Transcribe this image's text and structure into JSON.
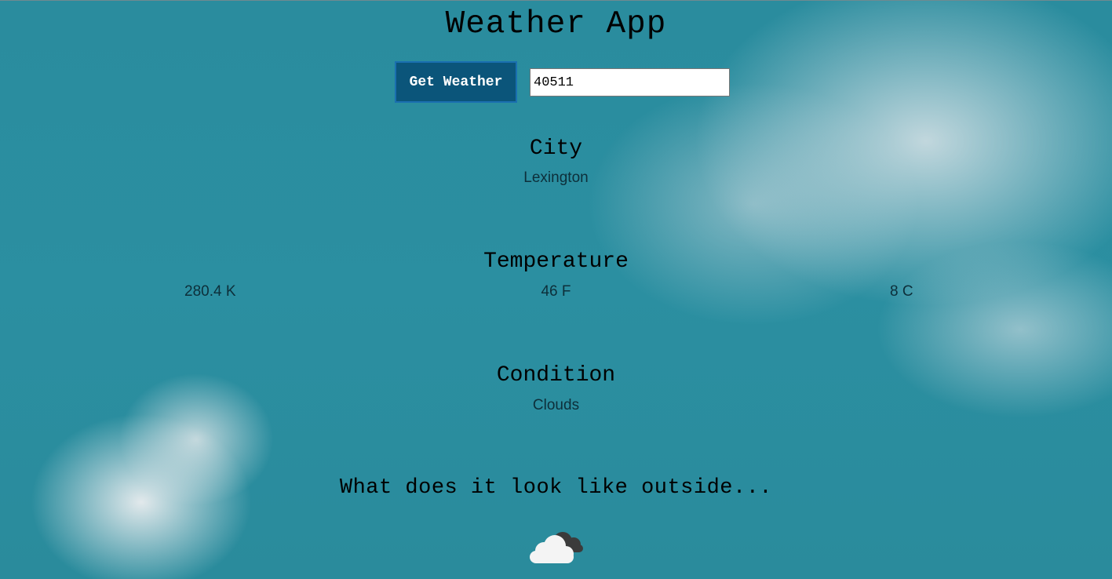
{
  "app": {
    "title": "Weather App"
  },
  "search": {
    "button_label": "Get Weather",
    "zip_value": "40511"
  },
  "city": {
    "heading": "City",
    "value": "Lexington"
  },
  "temperature": {
    "heading": "Temperature",
    "kelvin": "280.4 K",
    "fahrenheit": "46 F",
    "celsius": "8 C"
  },
  "condition": {
    "heading": "Condition",
    "value": "Clouds",
    "icon": "cloud-icon"
  },
  "outside": {
    "heading": "What does it look like outside..."
  },
  "colors": {
    "button_bg": "#0b557a",
    "button_border": "#1a6fb0",
    "sky": "#2c8fa0"
  }
}
